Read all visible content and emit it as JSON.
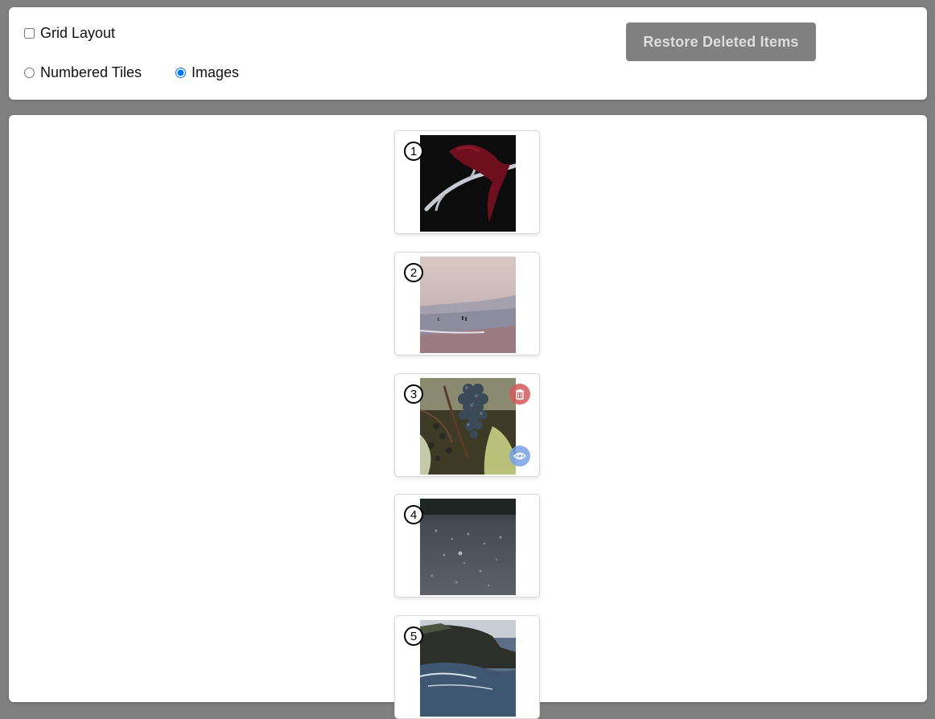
{
  "controls": {
    "grid_layout_label": "Grid Layout",
    "grid_layout_checked": false,
    "numbered_tiles_label": "Numbered Tiles",
    "images_label": "Images",
    "selected_mode": "Images",
    "restore_button_label": "Restore Deleted Items"
  },
  "tiles": [
    {
      "number": "1",
      "image": "red-ribbon-antler-photo"
    },
    {
      "number": "2",
      "image": "misty-beach-photo"
    },
    {
      "number": "3",
      "image": "grape-cluster-photo",
      "actions": [
        "trash-icon",
        "eye-icon"
      ]
    },
    {
      "number": "4",
      "image": "dark-textured-surface-photo"
    },
    {
      "number": "5",
      "image": "rocky-coast-photo"
    }
  ],
  "colors": {
    "page_background": "#808080",
    "panel_background": "#ffffff",
    "restore_button_background": "#808080",
    "delete_button": "#d25a5a",
    "view_button": "#78a0e6",
    "radio_accent": "#1a73e8"
  }
}
